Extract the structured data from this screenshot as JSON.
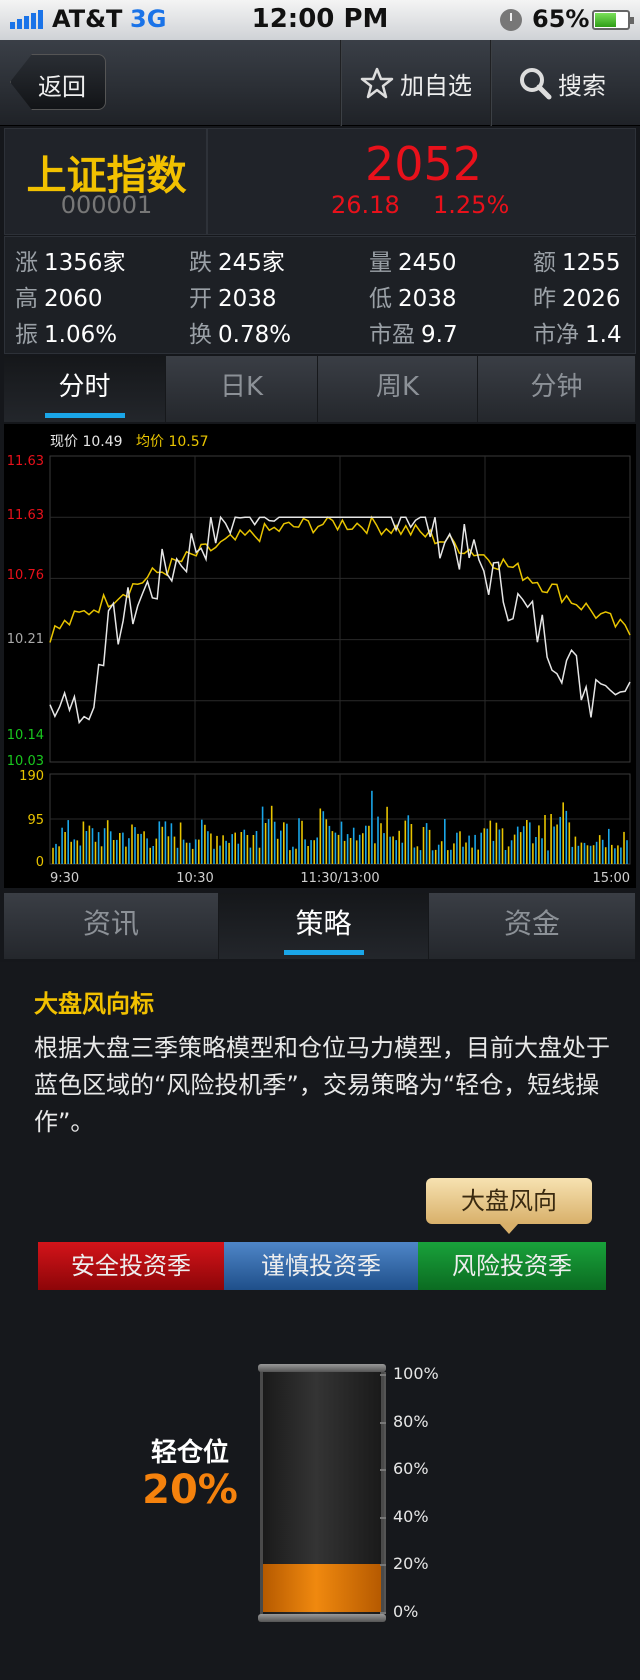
{
  "status_bar": {
    "carrier": "AT&T",
    "network": "3G",
    "time": "12:00 PM",
    "battery": "65%",
    "battery_level": 0.65
  },
  "nav": {
    "back_label": "返回",
    "add_watch_label": "加自选",
    "search_label": "搜索"
  },
  "quote": {
    "name": "上证指数",
    "code": "000001",
    "price": "2052",
    "change": "26.18",
    "change_pct": "1.25%"
  },
  "stats": [
    [
      {
        "k": "涨",
        "v": "1356家"
      },
      {
        "k": "跌",
        "v": "245家"
      },
      {
        "k": "量",
        "v": "2450"
      },
      {
        "k": "额",
        "v": "1255"
      }
    ],
    [
      {
        "k": "高",
        "v": "2060"
      },
      {
        "k": "开",
        "v": "2038"
      },
      {
        "k": "低",
        "v": "2038"
      },
      {
        "k": "昨",
        "v": "2026"
      }
    ],
    [
      {
        "k": "振",
        "v": "1.06%"
      },
      {
        "k": "换",
        "v": "0.78%"
      },
      {
        "k": "市盈",
        "v": "9.7"
      },
      {
        "k": "市净",
        "v": "1.4"
      }
    ]
  ],
  "chart_tabs": [
    "分时",
    "日K",
    "周K",
    "分钟"
  ],
  "chart_tab_active": 0,
  "chart_data": {
    "type": "line",
    "legend": {
      "current_label": "现价 10.49",
      "avg_label": "均价 10.57"
    },
    "y_ticks": [
      {
        "label": "11.63",
        "color": "#e8111b"
      },
      {
        "label": "11.63",
        "color": "#e8111b"
      },
      {
        "label": "10.76",
        "color": "#e8111b"
      },
      {
        "label": "10.21",
        "color": "#aaaaaa"
      },
      {
        "label": "10.14",
        "color": "#19c81e"
      },
      {
        "label": "10.03",
        "color": "#19c81e"
      }
    ],
    "x_ticks": [
      "9:30",
      "10:30",
      "11:30/13:00",
      "15:00"
    ],
    "volume_ticks": [
      "190",
      "95",
      "0"
    ],
    "colors": {
      "price": "#e6e6e6",
      "avg": "#e8c400",
      "volume_a": "#e8c400",
      "volume_b": "#1aa6e8"
    }
  },
  "section_tabs": [
    "资讯",
    "策略",
    "资金"
  ],
  "section_tab_active": 1,
  "strategy": {
    "title": "大盘风向标",
    "description": "根据大盘三季策略模型和仓位马力模型，目前大盘处于蓝色区域的“风险投机季”，交易策略为“轻仓，短线操作”。",
    "badge": "大盘风向",
    "seasons": [
      "安全投资季",
      "谨慎投资季",
      "风险投资季"
    ],
    "position_label": "轻仓位",
    "position_value": "20%",
    "position_fraction": 0.2,
    "scale_labels": [
      "100%",
      "80%",
      "60%",
      "40%",
      "20%",
      "0%"
    ]
  }
}
